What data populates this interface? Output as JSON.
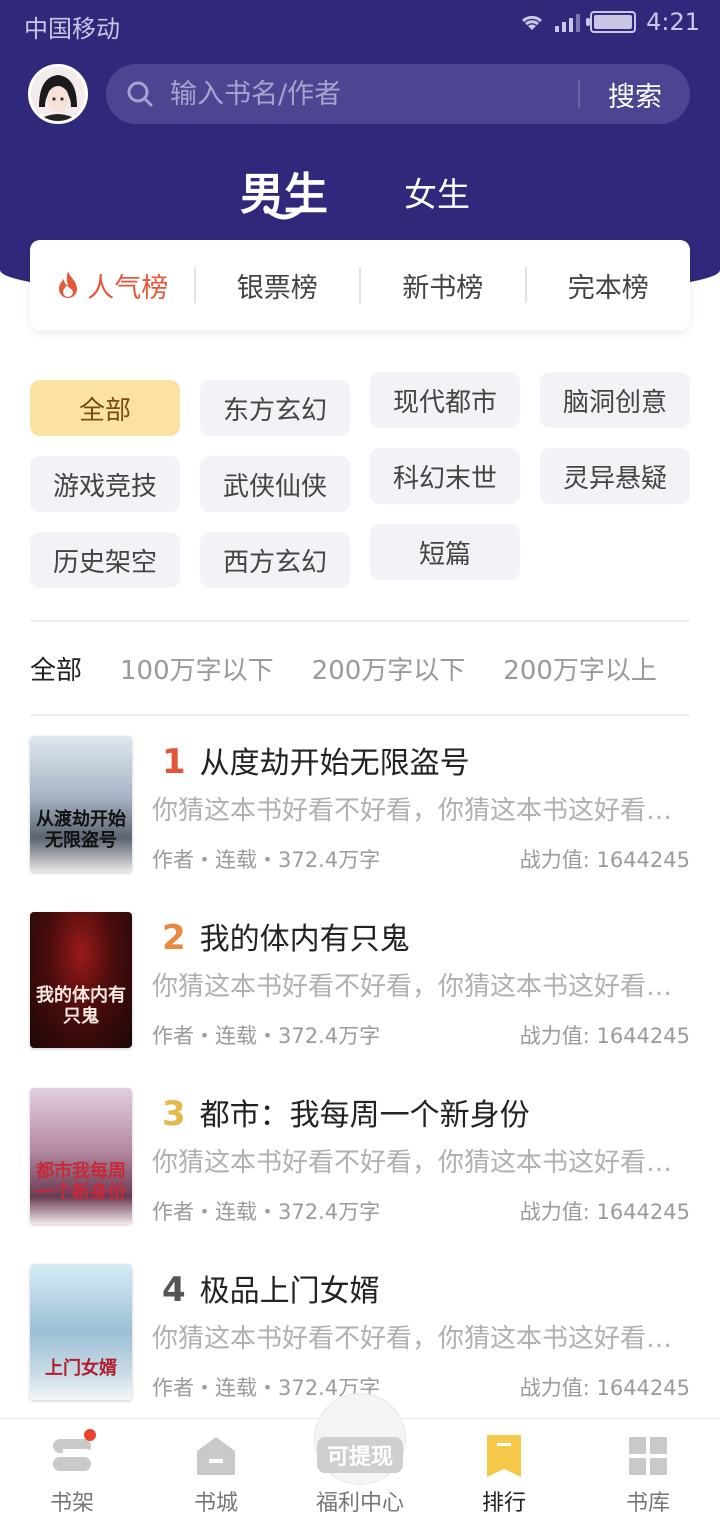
{
  "status_bar": {
    "carrier": "中国移动",
    "time": "4:21"
  },
  "header": {
    "search": {
      "placeholder": "输入书名/作者",
      "button": "搜索"
    },
    "gender_tabs": {
      "male": "男生",
      "female": "女生",
      "active": "male"
    }
  },
  "rank_tabs": [
    {
      "label": "人气榜",
      "active": true
    },
    {
      "label": "银票榜",
      "active": false
    },
    {
      "label": "新书榜",
      "active": false
    },
    {
      "label": "完本榜",
      "active": false
    }
  ],
  "categories": [
    {
      "label": "全部",
      "active": true
    },
    {
      "label": "东方玄幻",
      "active": false
    },
    {
      "label": "现代都市",
      "active": false
    },
    {
      "label": "脑洞创意",
      "active": false
    },
    {
      "label": "游戏竞技",
      "active": false
    },
    {
      "label": "武侠仙侠",
      "active": false
    },
    {
      "label": "科幻末世",
      "active": false
    },
    {
      "label": "灵异悬疑",
      "active": false
    },
    {
      "label": "历史架空",
      "active": false
    },
    {
      "label": "西方玄幻",
      "active": false
    },
    {
      "label": "短篇",
      "active": false
    }
  ],
  "word_count_filter": [
    {
      "label": "全部",
      "active": true
    },
    {
      "label": "100万字以下",
      "active": false
    },
    {
      "label": "200万字以下",
      "active": false
    },
    {
      "label": "200万字以上",
      "active": false
    }
  ],
  "books": [
    {
      "rank": "1",
      "rank_color": "#e0553c",
      "title": "从度劫开始无限盗号",
      "desc": "你猜这本书好看不好看，你猜这本书这好看不好看",
      "meta": "作者・连载・372.4万字",
      "power": "战力值: 1644245",
      "cover_text": "从渡劫开始无限盗号"
    },
    {
      "rank": "2",
      "rank_color": "#e8893f",
      "title": "我的体内有只鬼",
      "desc": "你猜这本书好看不好看，你猜这本书这好看不好看",
      "meta": "作者・连载・372.4万字",
      "power": "战力值: 1644245",
      "cover_text": "我的体内有只鬼"
    },
    {
      "rank": "3",
      "rank_color": "#e5b84c",
      "title": "都市：我每周一个新身份",
      "desc": "你猜这本书好看不好看，你猜这本书这好看不好看",
      "meta": "作者・连载・372.4万字",
      "power": "战力值: 1644245",
      "cover_text": "都市我每周一个新身份"
    },
    {
      "rank": "4",
      "rank_color": "#555555",
      "title": "极品上门女婿",
      "desc": "你猜这本书好看不好看，你猜这本书这好看不好看",
      "meta": "作者・连载・372.4万字",
      "power": "战力值: 1644245",
      "cover_text": "上门女婿"
    }
  ],
  "bottom_nav": [
    {
      "label": "书架",
      "icon": "bookshelf-icon",
      "active": false,
      "has_badge": true
    },
    {
      "label": "书城",
      "icon": "bookstore-icon",
      "active": false
    },
    {
      "label": "福利中心",
      "icon": "welfare-icon",
      "active": false,
      "badge_text": "可提现"
    },
    {
      "label": "排行",
      "icon": "ranking-icon",
      "active": true
    },
    {
      "label": "书库",
      "icon": "library-icon",
      "active": false
    }
  ],
  "colors": {
    "header_bg": "#30287a",
    "accent_red": "#e6573a",
    "chip_active": "#fbe1a2",
    "nav_active": "#f6c94a"
  }
}
